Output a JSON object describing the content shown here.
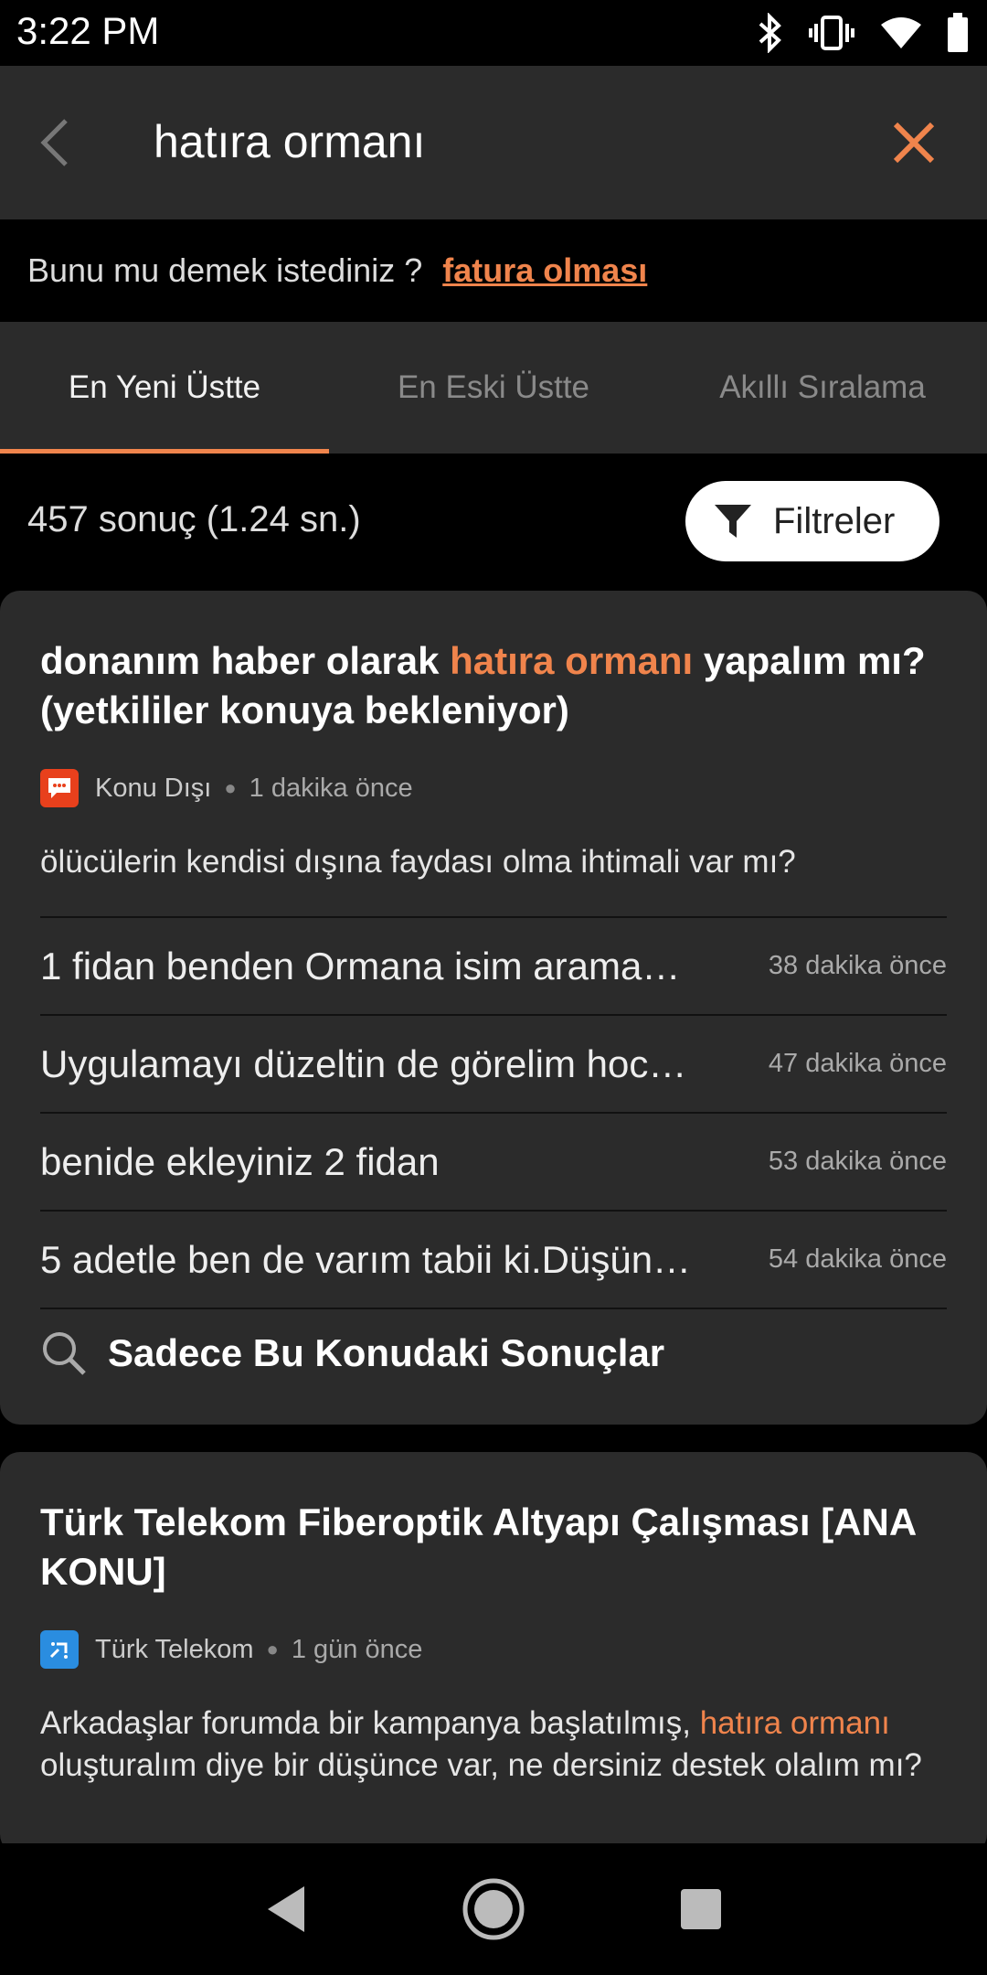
{
  "status_bar": {
    "time": "3:22 PM",
    "icons": [
      "bluetooth-icon",
      "vibrate-icon",
      "wifi-icon",
      "battery-icon"
    ]
  },
  "search": {
    "query": "hatıra ormanı",
    "back_icon": "chevron-left-icon",
    "clear_icon": "close-icon",
    "accent": "#f0844c"
  },
  "suggestion": {
    "label": "Bunu mu demek istediniz ?",
    "link": "fatura olması"
  },
  "tabs": [
    {
      "label": "En Yeni Üstte",
      "active": true
    },
    {
      "label": "En Eski Üstte",
      "active": false
    },
    {
      "label": "Akıllı Sıralama",
      "active": false
    }
  ],
  "results": {
    "count_text": "457 sonuç (1.24 sn.)",
    "filter_label": "Filtreler"
  },
  "cards": [
    {
      "title_before": "donanım haber olarak ",
      "title_highlight": "hatıra ormanı",
      "title_after": " yapalım mı? (yetkililer konuya bekleniyor)",
      "category": "Konu Dışı",
      "category_color": "#e8401c",
      "time": "1 dakika önce",
      "excerpt": "ölücülerin kendisi dışına faydası olma ihtimali var mı?",
      "replies": [
        {
          "text": "1 fidan benden Ormana isim arama…",
          "time": "38 dakika önce"
        },
        {
          "text": "Uygulamayı düzeltin de görelim hoc…",
          "time": "47 dakika önce"
        },
        {
          "text": "benide ekleyiniz 2 fidan",
          "time": "53 dakika önce"
        },
        {
          "text": "5 adetle ben de varım tabii ki.Düşün…",
          "time": "54 dakika önce"
        }
      ],
      "topic_search_label": "Sadece Bu Konudaki Sonuçlar"
    },
    {
      "title": "Türk Telekom Fiberoptik Altyapı Çalışması [ANA KONU]",
      "category": "Türk Telekom",
      "category_color": "#2a8de0",
      "time": "1 gün önce",
      "excerpt_before": "Arkadaşlar forumda bir kampanya başlatılmış, ",
      "excerpt_highlight": "hatıra ormanı",
      "excerpt_after": " oluşturalım diye bir düşünce var, ne dersiniz destek olalım mı?"
    }
  ],
  "nav_bar": {
    "icons": [
      "back-triangle-icon",
      "home-circle-icon",
      "recents-square-icon"
    ]
  }
}
